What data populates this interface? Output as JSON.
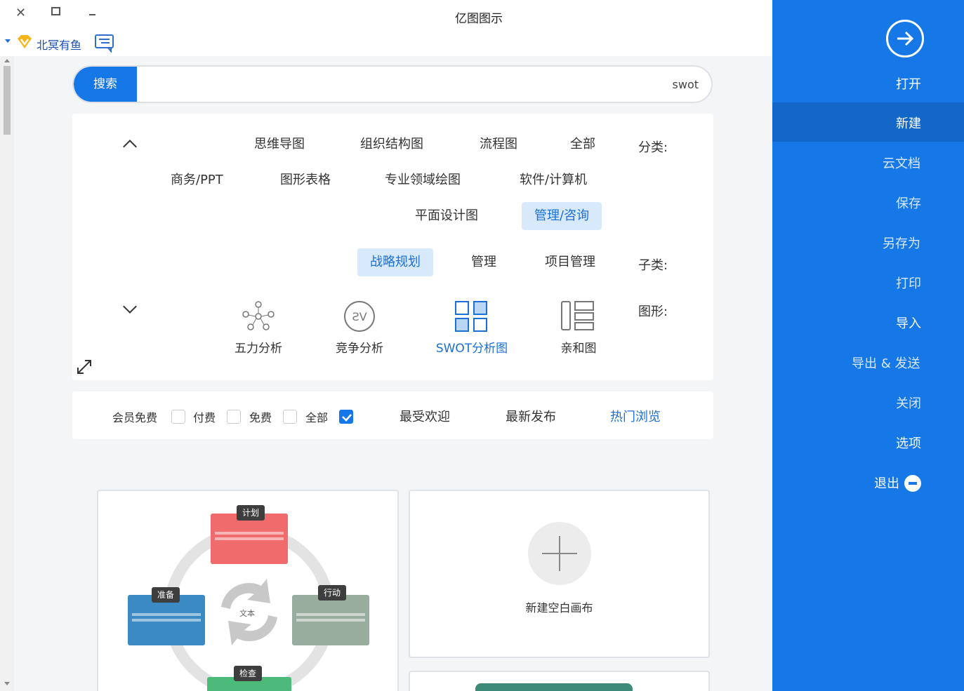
{
  "window": {
    "title": "亿图图示"
  },
  "user": {
    "name": "北冥有鱼"
  },
  "search": {
    "button_label": "搜索",
    "value": "swot"
  },
  "filters": {
    "category_label": "分类:",
    "categories": [
      "全部",
      "流程图",
      "组织结构图",
      "思维导图",
      "软件/计算机",
      "专业领域绘图",
      "图形表格",
      "商务/PPT",
      "管理/咨询",
      "平面设计图"
    ],
    "active_category": "管理/咨询",
    "subcategory_label": "子类:",
    "subcategories": [
      "项目管理",
      "管理",
      "战略规划"
    ],
    "active_subcategory": "战略规划",
    "shape_label": "图形:",
    "shapes": [
      "亲和图",
      "SWOT分析图",
      "竞争分析",
      "五力分析"
    ],
    "active_shape": "SWOT分析图"
  },
  "sort": {
    "options": [
      "热门浏览",
      "最新发布",
      "最受欢迎"
    ],
    "active": "热门浏览",
    "price_filters": [
      {
        "label": "全部",
        "checked": true
      },
      {
        "label": "免费",
        "checked": false
      },
      {
        "label": "付费",
        "checked": false
      },
      {
        "label": "会员免费",
        "checked": false
      }
    ]
  },
  "cards": {
    "new_blank_label": "新建空白画布",
    "template": {
      "center_text": "文本",
      "stages": [
        "计划",
        "行动",
        "检查",
        "准备"
      ]
    }
  },
  "sidebar": {
    "items": [
      "打开",
      "新建",
      "云文档",
      "保存",
      "另存为",
      "打印",
      "导入",
      "导出 & 发送",
      "关闭",
      "选项",
      "退出"
    ],
    "active": "新建"
  },
  "colors": {
    "accent": "#1677e6",
    "sidebar_active": "#1367c8",
    "chip_active_bg": "#d8e9fb",
    "plan_red": "#f06b6b",
    "act_gray": "#98ad9d",
    "prep_blue": "#3b8ac4",
    "check_green": "#4cbb7a"
  }
}
